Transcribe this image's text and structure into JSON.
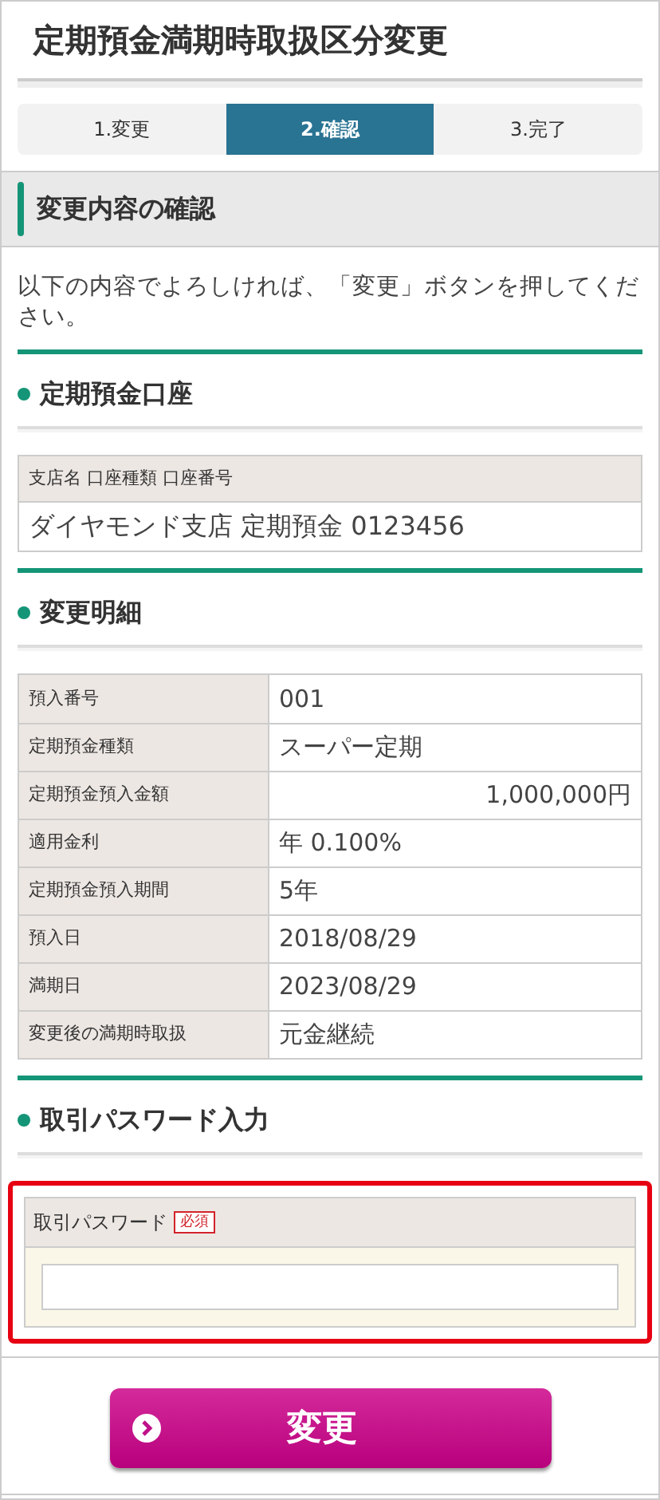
{
  "page_title": "定期預金満期時取扱区分変更",
  "steps": [
    {
      "label": "1.変更",
      "selected": false
    },
    {
      "label": "2.確認",
      "selected": true
    },
    {
      "label": "3.完了",
      "selected": false
    }
  ],
  "section_title": "変更内容の確認",
  "intro": "以下の内容でよろしければ、「変更」ボタンを押してください。",
  "account": {
    "heading": "定期預金口座",
    "label": "支店名 口座種類 口座番号",
    "value": "ダイヤモンド支店 定期預金 0123456"
  },
  "details": {
    "heading": "変更明細",
    "rows": [
      {
        "label": "預入番号",
        "value": "001",
        "kind": "text"
      },
      {
        "label": "定期預金種類",
        "value": "スーパー定期",
        "kind": "text"
      },
      {
        "label": "定期預金預入金額",
        "value": "1,000,000円",
        "kind": "amount"
      },
      {
        "label": "適用金利",
        "value": "年 0.100%",
        "kind": "text"
      },
      {
        "label": "定期預金預入期間",
        "value": "5年",
        "kind": "text"
      },
      {
        "label": "預入日",
        "value": "2018/08/29",
        "kind": "text"
      },
      {
        "label": "満期日",
        "value": "2023/08/29",
        "kind": "text"
      },
      {
        "label": "変更後の満期時取扱",
        "value": "元金継続",
        "kind": "text"
      }
    ]
  },
  "password": {
    "heading": "取引パスワード入力",
    "label": "取引パスワード",
    "badge": "必須",
    "error": true
  },
  "submit_button": "変更"
}
